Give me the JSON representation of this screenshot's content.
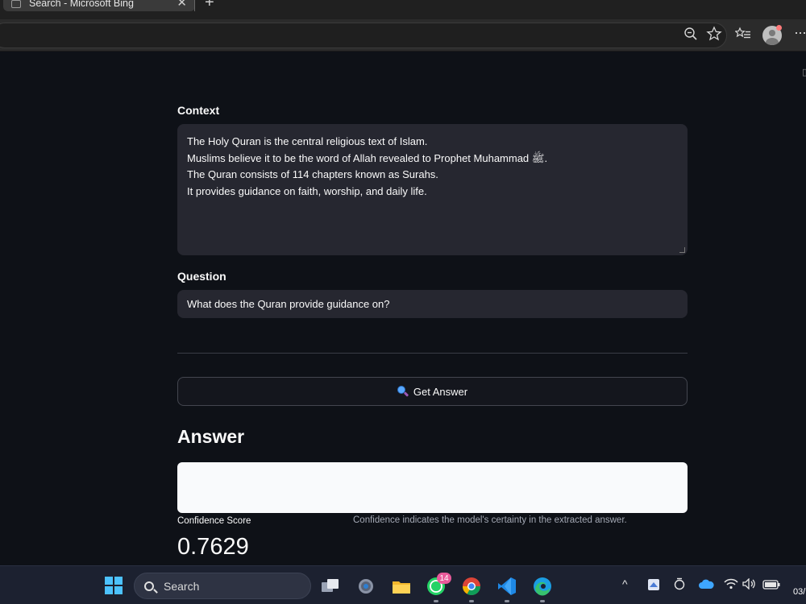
{
  "browser": {
    "tab_title": "Search - Microsoft Bing",
    "tab_close": "✕",
    "new_tab": "+"
  },
  "page": {
    "context": {
      "label": "Context",
      "lines": [
        "The Holy Quran is the central religious text of Islam.",
        "Muslims believe it to be the word of Allah revealed to Prophet Muhammad ﷺ.",
        "The Quran consists of 114 chapters known as Surahs.",
        "It provides guidance on faith, worship, and daily life."
      ]
    },
    "question": {
      "label": "Question",
      "value": "What does the Quran provide guidance on?"
    },
    "button": {
      "label": "Get Answer"
    },
    "answer": {
      "title": "Answer",
      "value": ""
    },
    "confidence": {
      "label": "Confidence Score",
      "help": "Confidence indicates the model's certainty in the extracted answer.",
      "value": "0.7629"
    }
  },
  "taskbar": {
    "search_label": "Search",
    "whatsapp_badge": "14",
    "clock": "03/"
  },
  "colors": {
    "app_bg": "#0e1117",
    "input_bg": "#262730",
    "accent_windows": "#4cc2ff"
  }
}
